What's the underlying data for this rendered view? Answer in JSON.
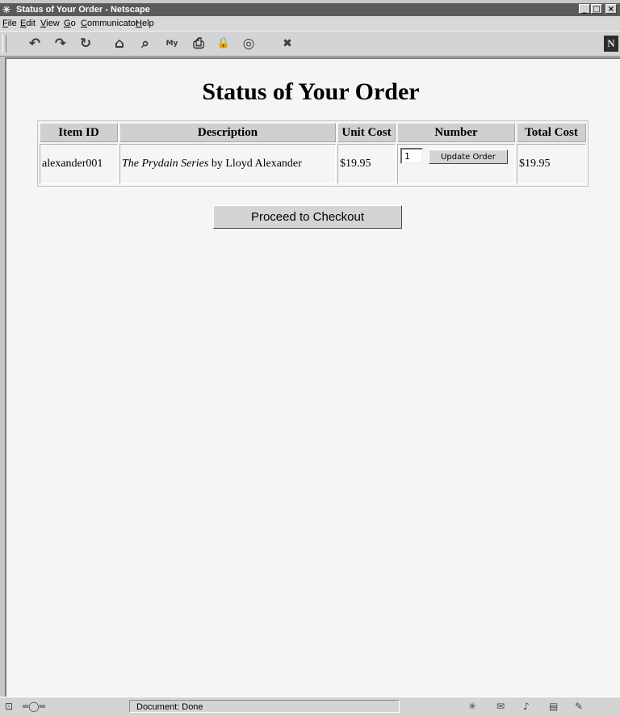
{
  "window": {
    "title": "Status of Your Order - Netscape",
    "min_label": "_",
    "max_label": "□",
    "close_label": "×"
  },
  "menu": [
    "File",
    "Edit",
    "View",
    "Go",
    "Communicator",
    "Help"
  ],
  "toolbar": {
    "icons": [
      "back-icon",
      "forward-icon",
      "reload-icon",
      "home-icon",
      "search-icon",
      "my-netscape-icon",
      "print-icon",
      "security-icon",
      "shop-icon",
      "stop-icon"
    ],
    "glyphs": [
      "↶",
      "↷",
      "↻",
      "⌂",
      "⌕",
      "▣",
      "⎙",
      "🔒",
      "◎",
      "✖"
    ],
    "my_label": "My",
    "logo": "N"
  },
  "page": {
    "heading": "Status of Your Order",
    "table": {
      "headers": [
        "Item ID",
        "Description",
        "Unit Cost",
        "Number",
        "Total Cost"
      ],
      "rows": [
        {
          "item_id": "alexander001",
          "title": "The Prydain Series",
          "byline": " by Lloyd Alexander",
          "unit_cost": "$19.95",
          "quantity": "1",
          "update_label": "Update Order",
          "total_cost": "$19.95"
        }
      ]
    },
    "checkout_label": "Proceed to Checkout"
  },
  "status": {
    "text": "Document: Done"
  }
}
